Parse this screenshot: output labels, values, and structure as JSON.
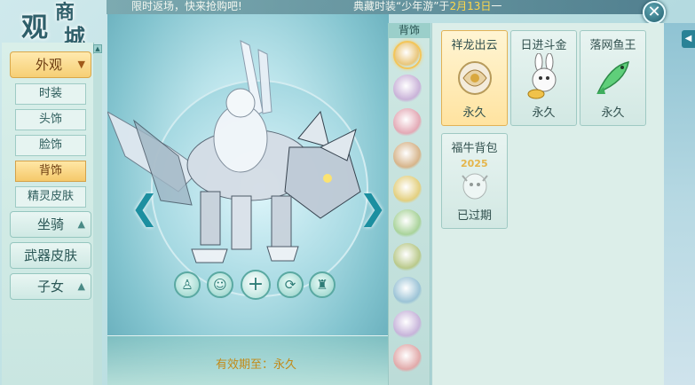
{
  "header": {
    "logo_char1": "观",
    "logo_char2": "商",
    "logo_char3": "城",
    "marquee_left": "限时返场，快来抢购吧!",
    "marquee_right_prefix": "典藏时装“少年游”于",
    "marquee_right_date": "2月13日",
    "marquee_right_suffix": "一"
  },
  "close_label": "✕",
  "side_tab_label": "◀",
  "nav": {
    "selected_category": "外观",
    "sub_items": [
      {
        "label": "时装",
        "active": false
      },
      {
        "label": "头饰",
        "active": false
      },
      {
        "label": "脸饰",
        "active": false
      },
      {
        "label": "背饰",
        "active": true
      },
      {
        "label": "精灵皮肤",
        "active": false
      }
    ],
    "categories": [
      {
        "label": "坐骑",
        "has_chevron": true
      },
      {
        "label": "武器皮肤",
        "has_chevron": false
      },
      {
        "label": "子女",
        "has_chevron": true
      }
    ]
  },
  "preview": {
    "expiry_text": "有效期至：永久",
    "left_arrow": "❮",
    "right_arrow": "❯",
    "controls": [
      {
        "icon": "person-icon",
        "glyph": "♙"
      },
      {
        "icon": "face-icon",
        "glyph": "☺"
      },
      {
        "icon": "plus-icon",
        "glyph": "+"
      },
      {
        "icon": "rotate-icon",
        "glyph": "⟳"
      },
      {
        "icon": "outfit-icon",
        "glyph": "♜"
      }
    ]
  },
  "thumbs": {
    "header": "背饰",
    "count": 10,
    "active_index": 0
  },
  "items": [
    {
      "name": "祥龙出云",
      "status": "永久",
      "active": true,
      "icon": "dragon-cloud-icon"
    },
    {
      "name": "日进斗金",
      "status": "永久",
      "active": false,
      "icon": "rabbit-gold-icon"
    },
    {
      "name": "落网鱼王",
      "status": "永久",
      "active": false,
      "icon": "fish-king-icon"
    },
    {
      "name": "福牛背包",
      "status": "已过期",
      "active": false,
      "icon": "ox-backpack-icon",
      "year": "2025"
    }
  ],
  "colors": {
    "accent_gold": "#f5c96a",
    "teal": "#2a8296",
    "expiry": "#c28a18"
  }
}
